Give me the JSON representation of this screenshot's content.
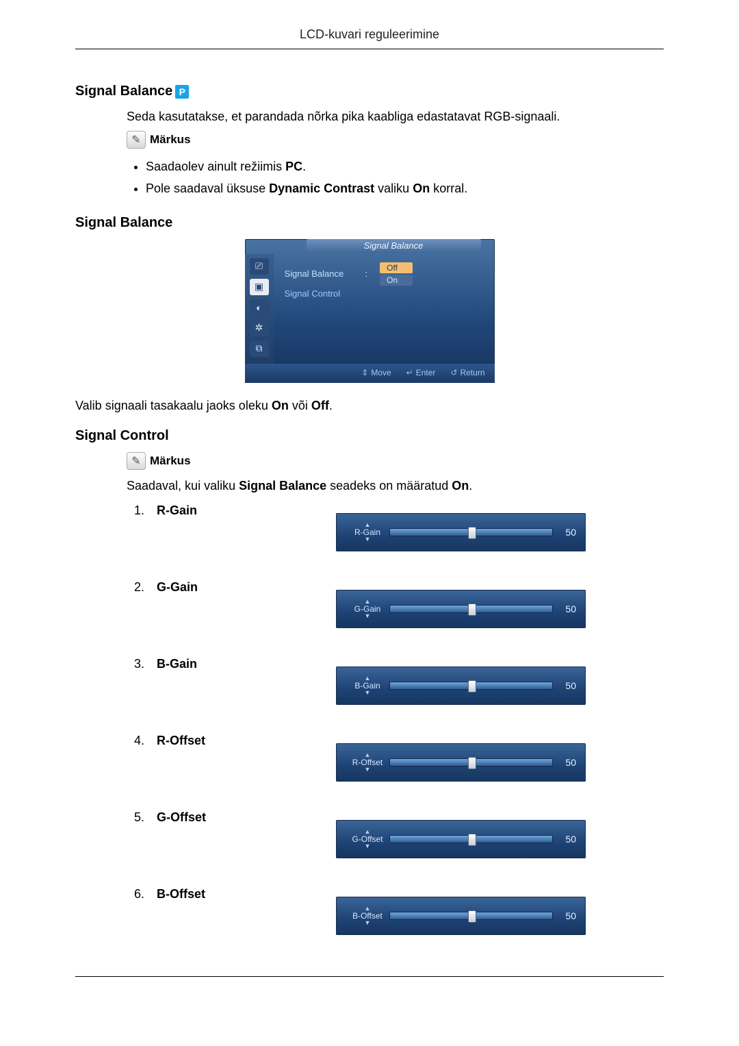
{
  "header": {
    "title": "LCD-kuvari reguleerimine"
  },
  "sec1": {
    "heading": "Signal Balance",
    "badge": "P",
    "intro": "Seda kasutatakse, et parandada nõrka pika kaabliga edastatavat RGB-signaali.",
    "note_label": "Märkus",
    "bullets": {
      "b1a": "Saadaolev ainult režiimis ",
      "b1b": "PC",
      "b1c": ".",
      "b2a": "Pole saadaval üksuse ",
      "b2b": "Dynamic Contrast",
      "b2c": " valiku ",
      "b2d": "On",
      "b2e": " korral."
    }
  },
  "sec2": {
    "heading": "Signal Balance",
    "osd": {
      "title": "Signal Balance",
      "row1_label": "Signal Balance",
      "row2_label": "Signal Control",
      "val_off": "Off",
      "val_on": "On",
      "footer_move": "Move",
      "footer_enter": "Enter",
      "footer_return": "Return"
    },
    "caption_a": "Valib signaali tasakaalu jaoks oleku ",
    "caption_b": "On",
    "caption_c": " või ",
    "caption_d": "Off",
    "caption_e": "."
  },
  "sec3": {
    "heading": "Signal Control",
    "note_label": "Märkus",
    "avail_a": "Saadaval, kui valiku ",
    "avail_b": "Signal Balance",
    "avail_c": " seadeks on määratud ",
    "avail_d": "On",
    "avail_e": ".",
    "items": [
      {
        "num": "1.",
        "label": "R-Gain",
        "slider": {
          "name": "R-Gain",
          "value": "50",
          "percent": 50
        }
      },
      {
        "num": "2.",
        "label": "G-Gain",
        "slider": {
          "name": "G-Gain",
          "value": "50",
          "percent": 50
        }
      },
      {
        "num": "3.",
        "label": "B-Gain",
        "slider": {
          "name": "B-Gain",
          "value": "50",
          "percent": 50
        }
      },
      {
        "num": "4.",
        "label": "R-Offset",
        "slider": {
          "name": "R-Offset",
          "value": "50",
          "percent": 50
        }
      },
      {
        "num": "5.",
        "label": "G-Offset",
        "slider": {
          "name": "G-Offset",
          "value": "50",
          "percent": 50
        }
      },
      {
        "num": "6.",
        "label": "B-Offset",
        "slider": {
          "name": "B-Offset",
          "value": "50",
          "percent": 50
        }
      }
    ]
  }
}
